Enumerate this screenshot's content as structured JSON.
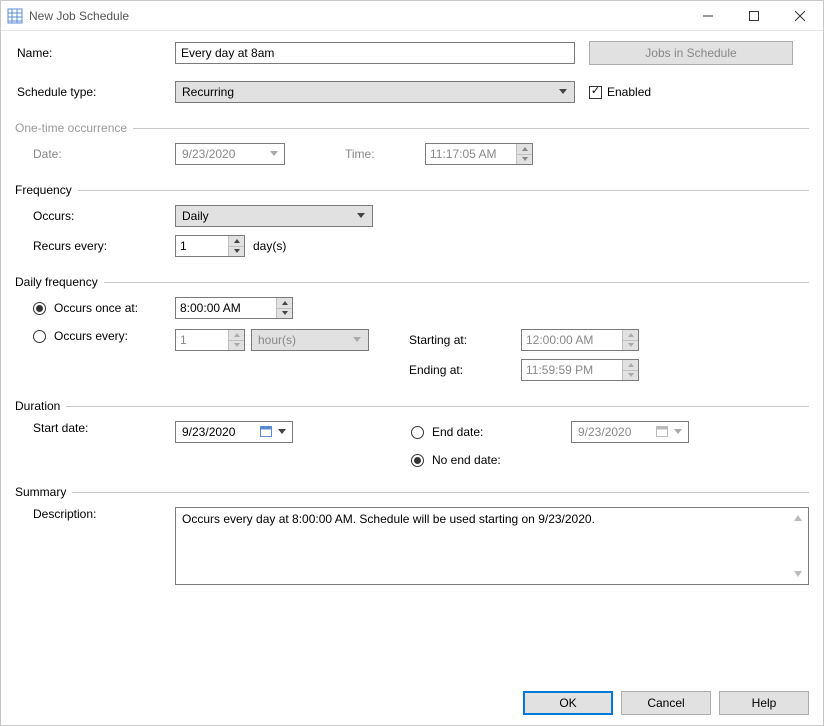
{
  "window": {
    "title": "New Job Schedule"
  },
  "labels": {
    "name": "Name:",
    "scheduleType": "Schedule type:",
    "enabled": "Enabled",
    "oneTime": "One-time occurrence",
    "date": "Date:",
    "time": "Time:",
    "frequency": "Frequency",
    "occurs": "Occurs:",
    "recursEvery": "Recurs every:",
    "daysUnit": "day(s)",
    "dailyFrequency": "Daily frequency",
    "occursOnceAt": "Occurs once at:",
    "occursEvery": "Occurs every:",
    "startingAt": "Starting at:",
    "endingAt": "Ending at:",
    "duration": "Duration",
    "startDate": "Start date:",
    "endDate": "End date:",
    "noEndDate": "No end date:",
    "summary": "Summary",
    "description": "Description:",
    "hoursUnit": "hour(s)"
  },
  "values": {
    "name": "Every day at 8am",
    "scheduleType": "Recurring",
    "enabledChecked": true,
    "oneTimeDate": "9/23/2020",
    "oneTimeTime": "11:17:05 AM",
    "occurs": "Daily",
    "recursEvery": "1",
    "occursOnceAtTime": "8:00:00 AM",
    "occursEveryValue": "1",
    "startingAt": "12:00:00 AM",
    "endingAt": "11:59:59 PM",
    "startDate": "9/23/2020",
    "endDate": "9/23/2020",
    "description": "Occurs every day at 8:00:00 AM. Schedule will be used starting on 9/23/2020."
  },
  "buttons": {
    "jobsInSchedule": "Jobs in Schedule",
    "ok": "OK",
    "cancel": "Cancel",
    "help": "Help"
  }
}
